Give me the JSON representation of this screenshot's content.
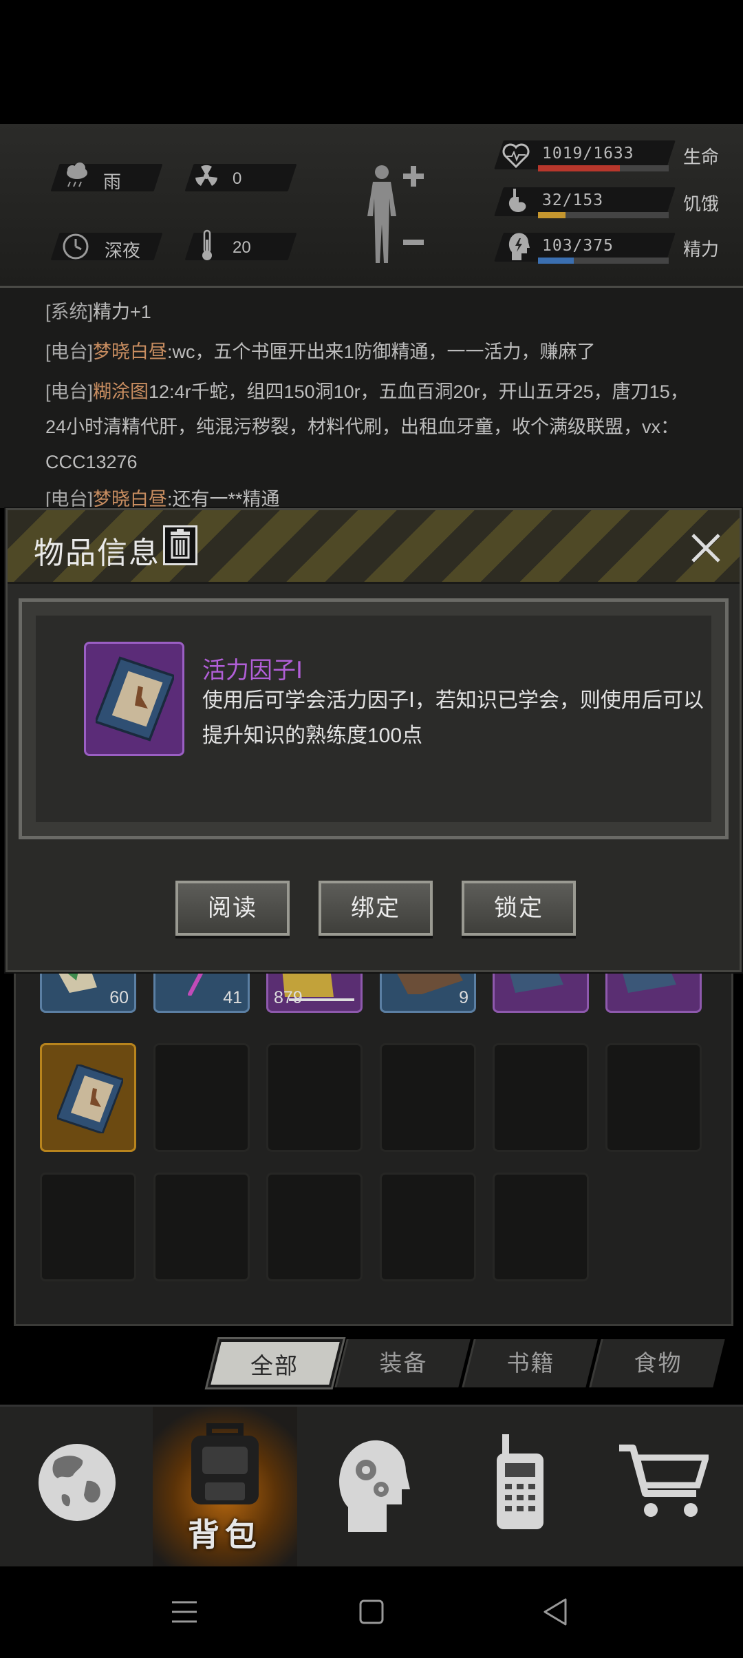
{
  "hud": {
    "weather_label": "雨",
    "radiation_value": "0",
    "time_label": "深夜",
    "temperature_value": "20",
    "stats": [
      {
        "value": "1019/1633",
        "name": "生命",
        "fraction": 0.624,
        "color": "#b8372c"
      },
      {
        "value": "32/153",
        "name": "饥饿",
        "fraction": 0.209,
        "color": "#c5962e"
      },
      {
        "value": "103/375",
        "name": "精力",
        "fraction": 0.275,
        "color": "#3b6fb0"
      }
    ]
  },
  "chat": {
    "line1": {
      "tag": "[系统]",
      "text": "精力+1"
    },
    "line2": {
      "tag": "[电台]",
      "user": "梦晓白昼",
      "text": ":wc，五个书匣开出来1防御精通，一一活力，赚麻了"
    },
    "line3": {
      "tag": "[电台]",
      "user": "糊涂图",
      "text": "12:4r千蛇，组四150洞10r，五血百洞20r，开山五牙25，唐刀15，24小时清精代肝，纯混污秽裂，材料代刷，出租血牙童，收个满级联盟，vx：CCC13276"
    },
    "line4": {
      "tag": "[电台]",
      "user": "梦晓白昼",
      "text": ":还有一**精通"
    }
  },
  "modal": {
    "title": "物品信息",
    "item_name": "活力因子Ⅰ",
    "item_desc": "使用后可学会活力因子Ⅰ，若知识已学会，则使用后可以提升知识的熟练度100点",
    "buttons": {
      "read": "阅读",
      "bind": "绑定",
      "lock": "锁定"
    }
  },
  "inventory": {
    "counts": [
      "60",
      "41",
      "879",
      "9"
    ]
  },
  "tabs": {
    "all": "全部",
    "equipment": "装备",
    "books": "书籍",
    "food": "食物"
  },
  "nav": {
    "backpack": "背包"
  }
}
